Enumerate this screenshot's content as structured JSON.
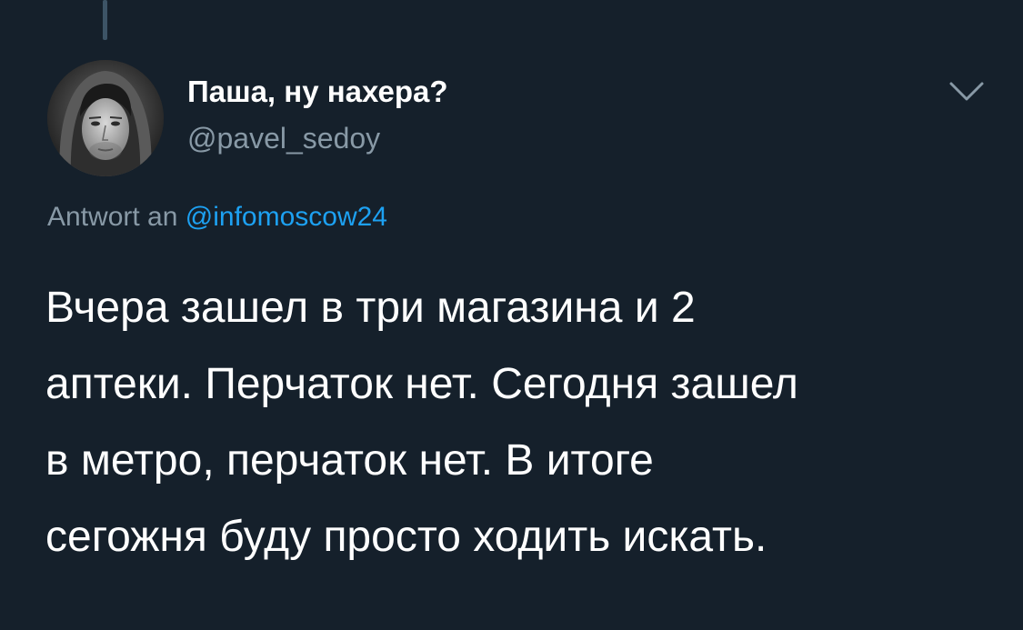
{
  "tweet": {
    "display_name": "Паша, ну нахера?",
    "handle": "@pavel_sedoy",
    "reply_prefix": "Antwort an",
    "reply_to": "@infomoscow24",
    "text_lines": [
      "Вчера зашел в три магазина и 2",
      "аптеки. Перчаток нет. Сегодня зашел",
      "в метро, перчаток нет. В итоге",
      "сегожня буду просто ходить искать."
    ]
  },
  "icons": {
    "avatar": "avatar",
    "menu": "chevron-down-icon"
  },
  "colors": {
    "background": "#15202b",
    "primary_text": "#ffffff",
    "secondary_text": "#8899a6",
    "link": "#1da1f2",
    "thread_line": "#3d5466"
  }
}
